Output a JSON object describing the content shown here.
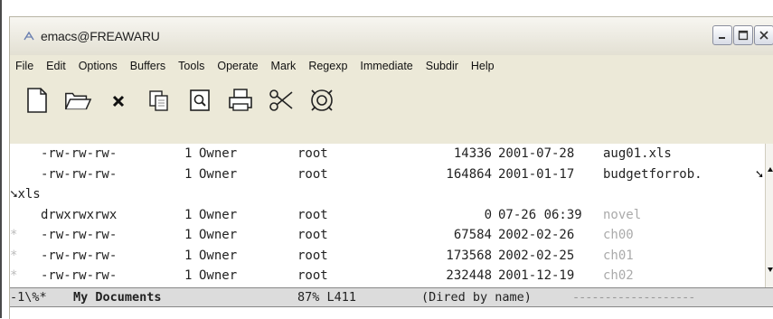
{
  "window": {
    "title": "emacs@FREAWARU"
  },
  "menu": [
    "File",
    "Edit",
    "Options",
    "Buffers",
    "Tools",
    "Operate",
    "Mark",
    "Regexp",
    "Immediate",
    "Subdir",
    "Help"
  ],
  "toolbar": [
    "new-file-icon",
    "open-folder-icon",
    "close-buffer-icon",
    "copy-icon",
    "search-icon",
    "print-icon",
    "cut-icon",
    "settings-icon"
  ],
  "files": [
    {
      "marker": "",
      "perms": "-rw-rw-rw-",
      "links": "1",
      "owner": "Owner",
      "group": "root",
      "size": "14336",
      "date": "2001-07-28",
      "name": "aug01.xls",
      "dim": false
    },
    {
      "marker": "",
      "perms": "-rw-rw-rw-",
      "links": "1",
      "owner": "Owner",
      "group": "root",
      "size": "164864",
      "date": "2001-01-17",
      "name": "budgetforrob.",
      "continuation": "xls",
      "dim": false
    },
    {
      "marker": "",
      "perms": "drwxrwxrwx",
      "links": "1",
      "owner": "Owner",
      "group": "root",
      "size": "0",
      "date": "07-26 06:39",
      "name": "novel",
      "dim": true
    },
    {
      "marker": "*",
      "perms": "-rw-rw-rw-",
      "links": "1",
      "owner": "Owner",
      "group": "root",
      "size": "67584",
      "date": "2002-02-26",
      "name": "ch00",
      "dim": true
    },
    {
      "marker": "*",
      "perms": "-rw-rw-rw-",
      "links": "1",
      "owner": "Owner",
      "group": "root",
      "size": "173568",
      "date": "2002-02-25",
      "name": "ch01",
      "dim": true
    },
    {
      "marker": "*",
      "perms": "-rw-rw-rw-",
      "links": "1",
      "owner": "Owner",
      "group": "root",
      "size": "232448",
      "date": "2001-12-19",
      "name": "ch02",
      "dim": true
    }
  ],
  "modeline": {
    "status": "-1\\%*",
    "buffer": "My Documents",
    "position": "87% L411",
    "mode": "(Dired by name)",
    "dashes": "-------------------"
  }
}
